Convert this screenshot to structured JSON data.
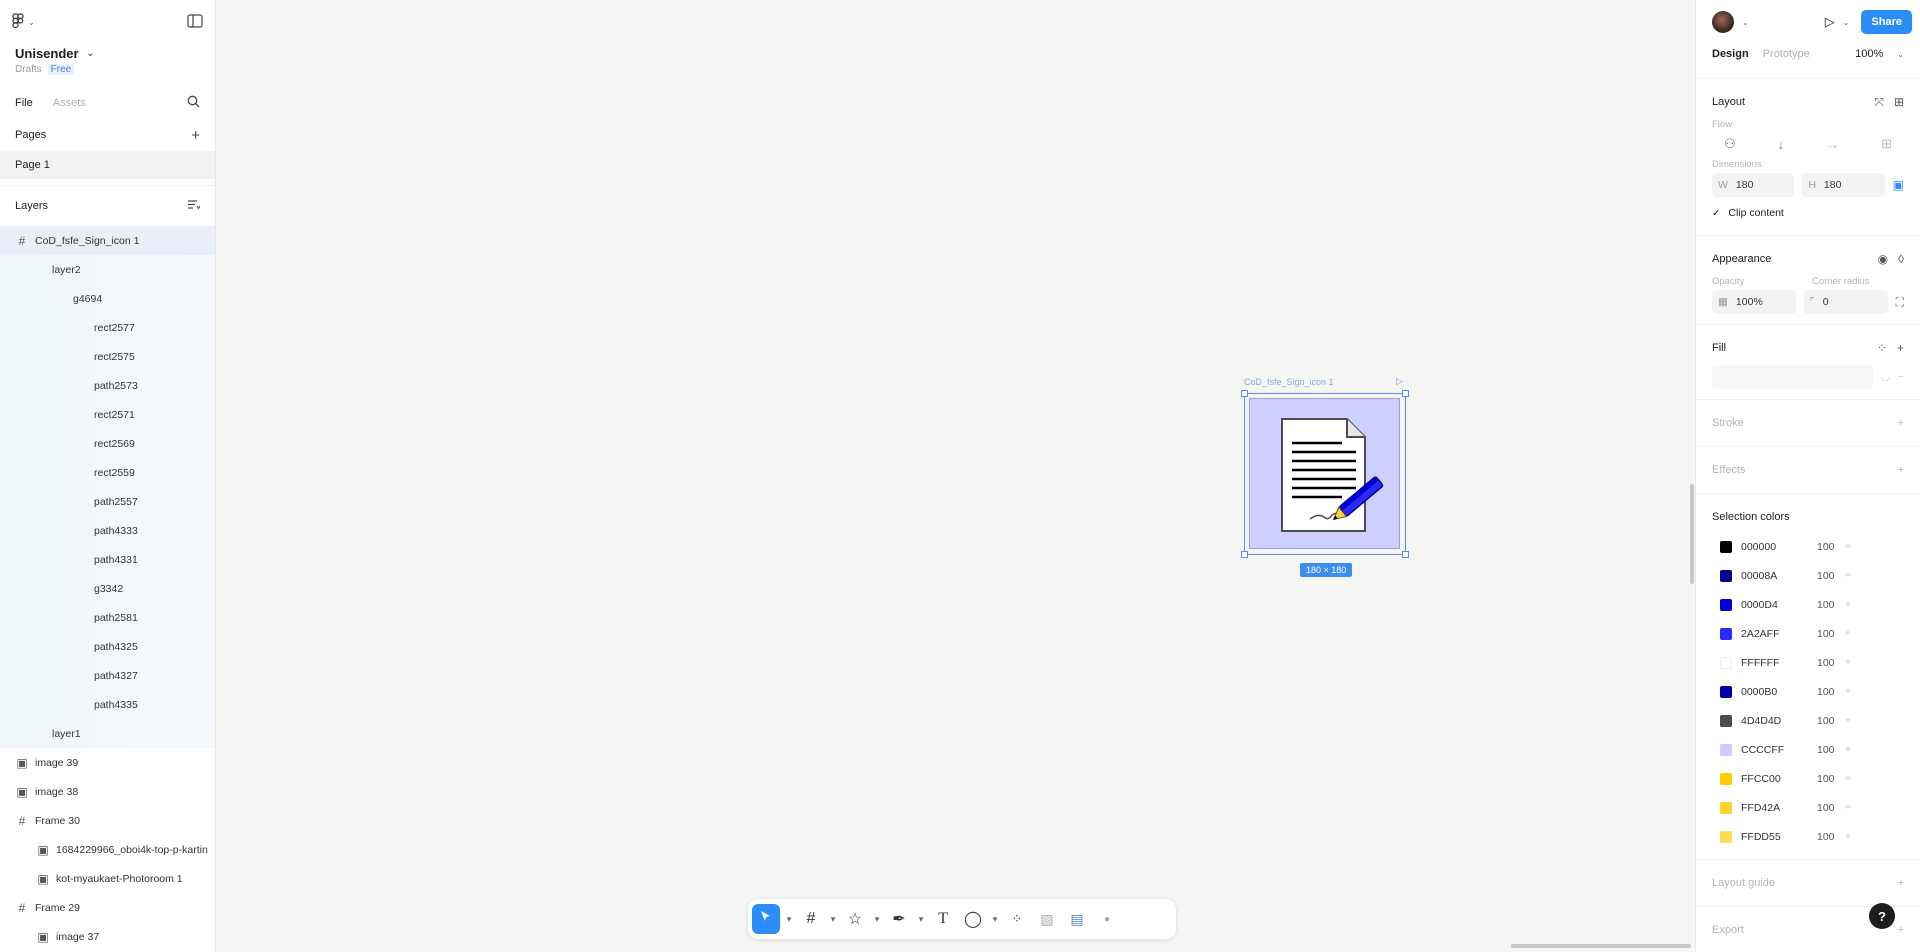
{
  "project": {
    "name": "Unisender",
    "drafts": "Drafts",
    "plan": "Free"
  },
  "left_tabs": {
    "file": "File",
    "assets": "Assets"
  },
  "pages": {
    "title": "Pages",
    "items": [
      "Page 1"
    ]
  },
  "layers": {
    "title": "Layers",
    "items": [
      {
        "label": "CoD_fsfe_Sign_icon 1",
        "indent": 0,
        "icon": "frame-icon",
        "selected": true
      },
      {
        "label": "layer2",
        "indent": 1,
        "icon": "",
        "selected": false
      },
      {
        "label": "g4694",
        "indent": 2,
        "icon": "",
        "selected": false
      },
      {
        "label": "rect2577",
        "indent": 3,
        "icon": "",
        "selected": false
      },
      {
        "label": "rect2575",
        "indent": 3,
        "icon": "",
        "selected": false
      },
      {
        "label": "path2573",
        "indent": 3,
        "icon": "",
        "selected": false
      },
      {
        "label": "rect2571",
        "indent": 3,
        "icon": "",
        "selected": false
      },
      {
        "label": "rect2569",
        "indent": 3,
        "icon": "",
        "selected": false
      },
      {
        "label": "rect2559",
        "indent": 3,
        "icon": "",
        "selected": false
      },
      {
        "label": "path2557",
        "indent": 3,
        "icon": "",
        "selected": false
      },
      {
        "label": "path4333",
        "indent": 3,
        "icon": "",
        "selected": false
      },
      {
        "label": "path4331",
        "indent": 3,
        "icon": "",
        "selected": false
      },
      {
        "label": "g3342",
        "indent": 3,
        "icon": "",
        "selected": false
      },
      {
        "label": "path2581",
        "indent": 3,
        "icon": "",
        "selected": false
      },
      {
        "label": "path4325",
        "indent": 3,
        "icon": "",
        "selected": false
      },
      {
        "label": "path4327",
        "indent": 3,
        "icon": "",
        "selected": false
      },
      {
        "label": "path4335",
        "indent": 3,
        "icon": "",
        "selected": false
      },
      {
        "label": "layer1",
        "indent": 1,
        "icon": "",
        "selected": false
      },
      {
        "label": "image 39",
        "indent": 0,
        "icon": "image-icon",
        "selected": false
      },
      {
        "label": "image 38",
        "indent": 0,
        "icon": "image-icon",
        "selected": false
      },
      {
        "label": "Frame 30",
        "indent": 0,
        "icon": "frame-icon",
        "selected": false
      },
      {
        "label": "1684229966_oboi4k-top-p-kartin",
        "indent": 1,
        "icon": "image-icon",
        "selected": false
      },
      {
        "label": "kot-myaukaet-Photoroom 1",
        "indent": 1,
        "icon": "image-icon",
        "selected": false
      },
      {
        "label": "Frame 29",
        "indent": 0,
        "icon": "frame-icon",
        "selected": false
      },
      {
        "label": "image 37",
        "indent": 1,
        "icon": "image-icon",
        "selected": false
      }
    ]
  },
  "canvas": {
    "frame_name": "CoD_fsfe_Sign_icon 1",
    "size_label": "180 × 180"
  },
  "right_panel": {
    "share": "Share",
    "tabs": {
      "design": "Design",
      "prototype": "Prototype",
      "zoom": "100%"
    },
    "layout": {
      "title": "Layout",
      "flow": "Flow",
      "dimensions": "Dimensions",
      "w_label": "W",
      "w_value": "180",
      "h_label": "H",
      "h_value": "180",
      "clip": "Clip content"
    },
    "appearance": {
      "title": "Appearance",
      "opacity_label": "Opacity",
      "opacity_value": "100%",
      "radius_label": "Corner radius",
      "radius_value": "0"
    },
    "fill": {
      "title": "Fill"
    },
    "stroke": {
      "title": "Stroke"
    },
    "effects": {
      "title": "Effects"
    },
    "selection_colors": {
      "title": "Selection colors",
      "items": [
        {
          "hex": "000000",
          "pct": "100",
          "color": "#000000"
        },
        {
          "hex": "00008A",
          "pct": "100",
          "color": "#00008A"
        },
        {
          "hex": "0000D4",
          "pct": "100",
          "color": "#0000D4"
        },
        {
          "hex": "2A2AFF",
          "pct": "100",
          "color": "#2A2AFF"
        },
        {
          "hex": "FFFFFF",
          "pct": "100",
          "color": "#FFFFFF"
        },
        {
          "hex": "0000B0",
          "pct": "100",
          "color": "#0000B0"
        },
        {
          "hex": "4D4D4D",
          "pct": "100",
          "color": "#4D4D4D"
        },
        {
          "hex": "CCCCFF",
          "pct": "100",
          "color": "#CCCCFF"
        },
        {
          "hex": "FFCC00",
          "pct": "100",
          "color": "#FFCC00"
        },
        {
          "hex": "FFD42A",
          "pct": "100",
          "color": "#FFD42A"
        },
        {
          "hex": "FFDD55",
          "pct": "100",
          "color": "#FFDD55"
        }
      ]
    },
    "layout_guide": {
      "title": "Layout guide"
    },
    "export": {
      "title": "Export"
    }
  },
  "colors": {
    "accent": "#2C8DF6",
    "canvas_bg": "#F5F5F3",
    "frame_fill": "#CCCFFF"
  }
}
